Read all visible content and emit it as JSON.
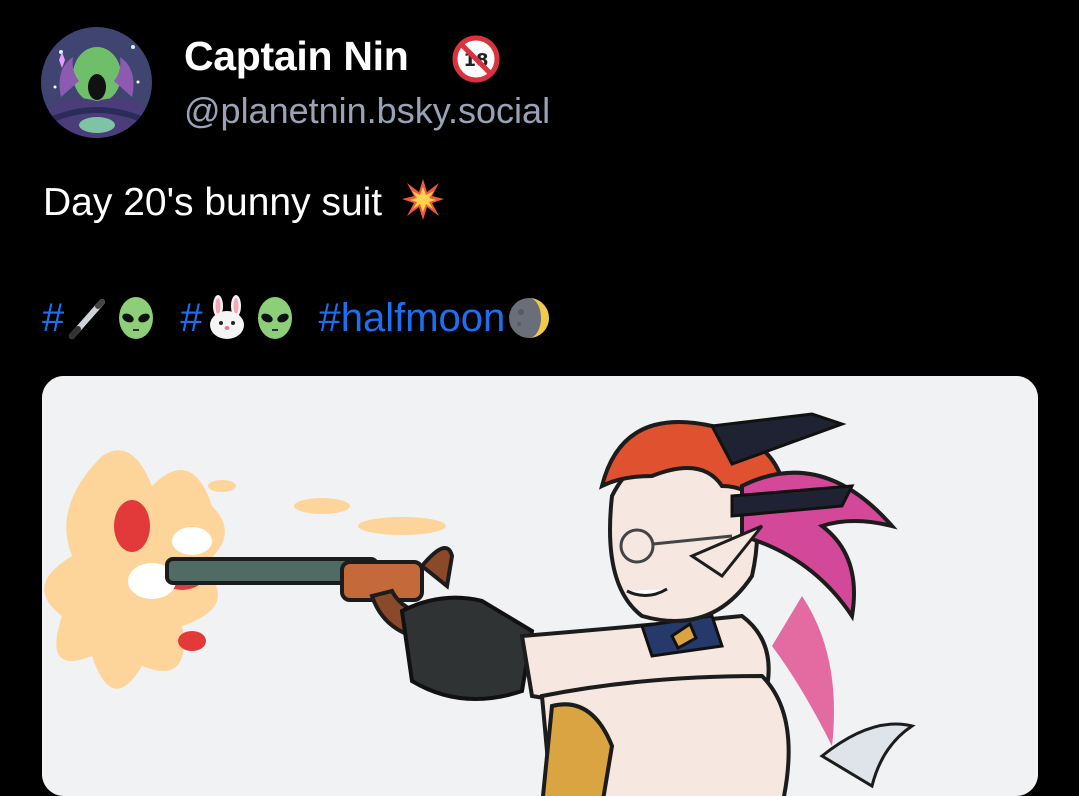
{
  "author": {
    "display_name": "Captain Nin",
    "handle": "@planetnin.bsky.social",
    "badge_icon": "adults-only-icon",
    "avatar_icon": "alien-character-avatar"
  },
  "post": {
    "text": "Day 20's bunny suit",
    "text_emoji": "collision-icon",
    "hashtags": [
      {
        "text": "#",
        "emojis": [
          "pen-icon",
          "alien-icon"
        ]
      },
      {
        "text": "#",
        "emojis": [
          "rabbit-face-icon",
          "alien-icon"
        ]
      },
      {
        "text": "#halfmoon",
        "emojis": [
          "moon-icon"
        ]
      }
    ],
    "image_icon": "artwork-bunny-suit-gunslinger"
  },
  "colors": {
    "background": "#000000",
    "link": "#1d6ff2",
    "handle": "#9aa3b5"
  }
}
